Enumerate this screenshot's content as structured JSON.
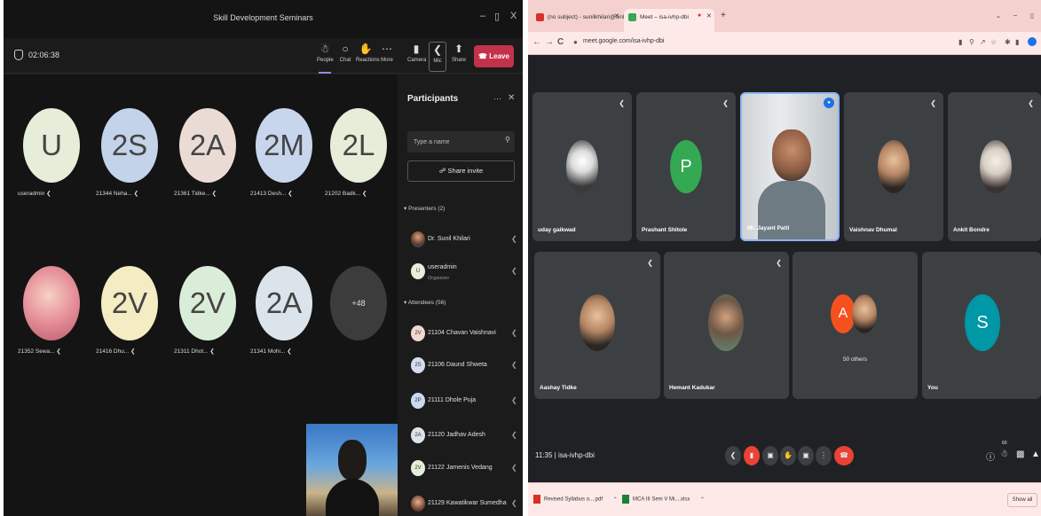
{
  "teams": {
    "window_title": "Skill Development Seminars",
    "window_controls": [
      "–",
      "▯",
      "X"
    ],
    "timer": "02:06:38",
    "toolbar": {
      "people": "People",
      "chat": "Chat",
      "reactions": "Reactions",
      "more": "More",
      "camera": "Camera",
      "mic": "Mic",
      "share": "Share",
      "leave": "Leave"
    },
    "tiles": [
      {
        "initials": "U",
        "name": "useradmin",
        "color": "#e6eed9"
      },
      {
        "initials": "2S",
        "name": "21344 Neha...",
        "color": "#c3d3ea"
      },
      {
        "initials": "2A",
        "name": "21361 Tidke...",
        "color": "#eadcd4"
      },
      {
        "initials": "2M",
        "name": "21413 Desh...",
        "color": "#c7d6ec"
      },
      {
        "initials": "2L",
        "name": "21202 Badk...",
        "color": "#e6edd8"
      },
      {
        "initials": "",
        "name": "21352 Sewa...",
        "color": "#e8a3a8"
      },
      {
        "initials": "2V",
        "name": "21416 Dhu...",
        "color": "#f4ecc2"
      },
      {
        "initials": "2V",
        "name": "21311 Dhot...",
        "color": "#daedd8"
      },
      {
        "initials": "2A",
        "name": "21341 Mohi...",
        "color": "#dbe4ea"
      },
      {
        "initials": "+48",
        "name": "",
        "color": "#3c3c3c"
      }
    ],
    "panel": {
      "title": "Participants",
      "search_placeholder": "Type a name",
      "share_invite": "Share invite",
      "presenters_heading": "Presenters (2)",
      "presenters": [
        {
          "initials": "",
          "name": "Dr. Sunil Khilari",
          "sub": ""
        },
        {
          "initials": "U",
          "name": "useradmin",
          "sub": "Organizer"
        }
      ],
      "attendees_heading": "Attendees (56)",
      "attendees": [
        {
          "initials": "2V",
          "name": "21104 Chavan Vaishnavi",
          "color": "#f0d8cf"
        },
        {
          "initials": "2S",
          "name": "21106 Daund Shweta",
          "color": "#d6dcf0"
        },
        {
          "initials": "2P",
          "name": "21111 Dhole Puja",
          "color": "#c9d9f1"
        },
        {
          "initials": "2A",
          "name": "21120 Jadhav Adesh",
          "color": "#dde3ea"
        },
        {
          "initials": "2V",
          "name": "21122 Jamenis Vedang",
          "color": "#e3efd8"
        },
        {
          "initials": "",
          "name": "21129 Kawatikwar Sumedha",
          "color": "#c98a6a"
        }
      ]
    }
  },
  "chrome": {
    "tabs": [
      {
        "title": "(no subject) - sunilkhilari@sinhg...",
        "icon_color": "#d93025"
      },
      {
        "title": "Meet – isa-ivhp-dbi",
        "icon_color": "#34a853"
      }
    ],
    "url": "meet.google.com/isa-ivhp-dbi",
    "meet": {
      "tiles": [
        {
          "name": "uday gaikwad",
          "type": "photo"
        },
        {
          "name": "Prashant Shitole",
          "type": "letter",
          "letter": "P",
          "color": "#34a853"
        },
        {
          "name": "Mr. Jayant Patil",
          "type": "video"
        },
        {
          "name": "Vaishnav Dhumal",
          "type": "photo"
        },
        {
          "name": "Ankit Bondre",
          "type": "photo"
        },
        {
          "name": "Aashay Tidke",
          "type": "photo"
        },
        {
          "name": "Hemant Kadukar",
          "type": "photo"
        },
        {
          "name": "50 others",
          "type": "others",
          "letter": "A",
          "color": "#f4511e"
        },
        {
          "name": "You",
          "type": "letter",
          "letter": "S",
          "color": "#0097a7"
        }
      ],
      "time_code": "11:35  |  isa-ivhp-dbi",
      "participant_count": "60"
    },
    "downloads": [
      {
        "name": "Revised Syllabus o....pdf",
        "icon_color": "#d93025"
      },
      {
        "name": "MCA III Sem V Mi....xlsx",
        "icon_color": "#188038"
      }
    ],
    "show_all": "Show all"
  }
}
